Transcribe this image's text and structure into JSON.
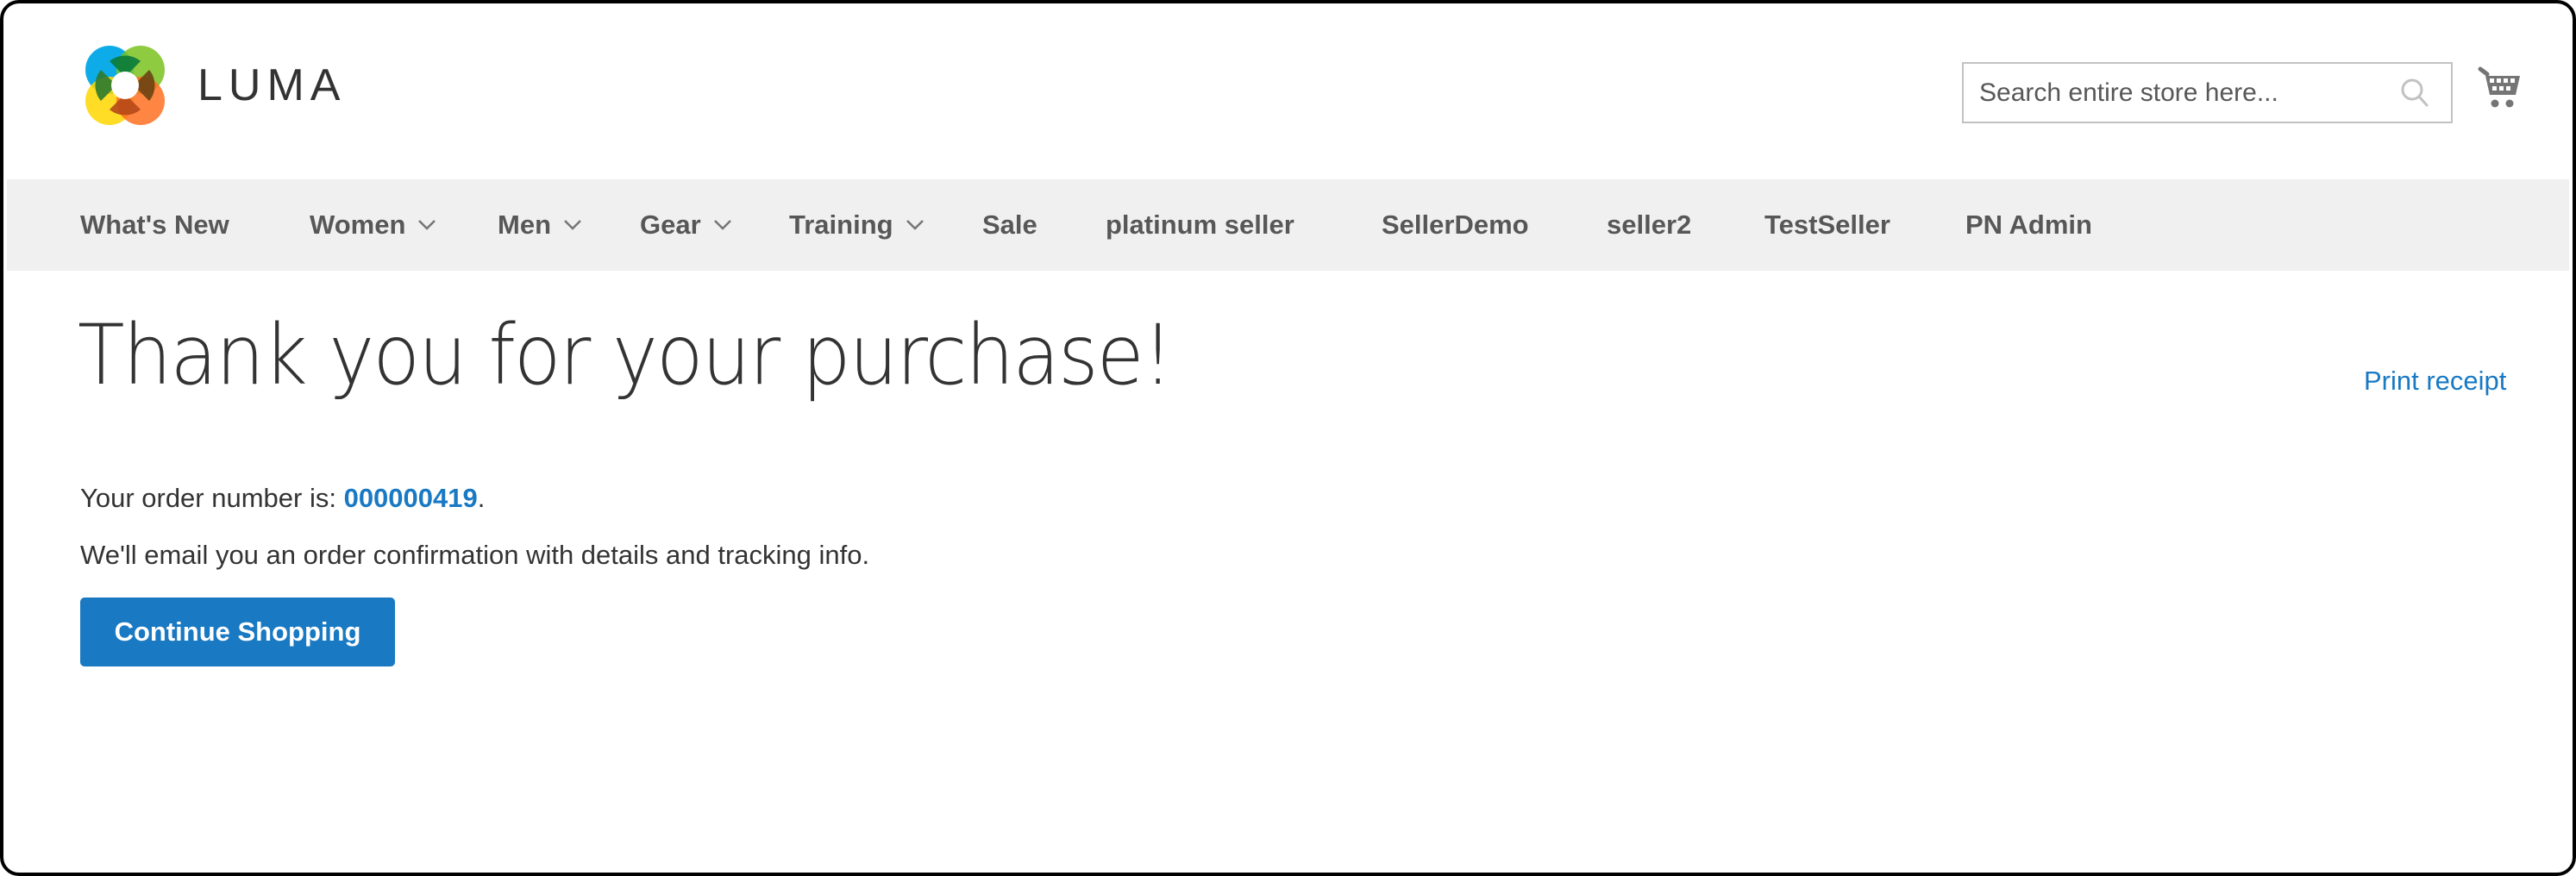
{
  "header": {
    "logo_text": "LUMA",
    "logo_icon": "luma-logo-icon",
    "search": {
      "placeholder": "Search entire store here...",
      "value": "",
      "icon": "search-icon"
    },
    "cart_icon": "cart-icon"
  },
  "nav": {
    "items": [
      {
        "label": "What's New",
        "has_dropdown": false
      },
      {
        "label": "Women",
        "has_dropdown": true
      },
      {
        "label": "Men",
        "has_dropdown": true
      },
      {
        "label": "Gear",
        "has_dropdown": true
      },
      {
        "label": "Training",
        "has_dropdown": true
      },
      {
        "label": "Sale",
        "has_dropdown": false
      },
      {
        "label": "platinum seller",
        "has_dropdown": false
      },
      {
        "label": "SellerDemo",
        "has_dropdown": false
      },
      {
        "label": "seller2",
        "has_dropdown": false
      },
      {
        "label": "TestSeller",
        "has_dropdown": false
      },
      {
        "label": "PN Admin",
        "has_dropdown": false
      }
    ]
  },
  "main": {
    "title": "Thank you for your purchase!",
    "print_receipt": "Print receipt",
    "order_prefix": "Your order number is: ",
    "order_number": "000000419",
    "order_suffix": ".",
    "email_message": "We'll email you an order confirmation with details and tracking info.",
    "continue_button": "Continue Shopping"
  },
  "colors": {
    "accent": "#1979c3",
    "nav_background": "#f0f0f0",
    "text": "#333333",
    "nav_text": "#575757",
    "logo_blue": "#00a8e8",
    "logo_green": "#7ac21e",
    "logo_yellow": "#ffd600",
    "logo_orange": "#ff7021"
  }
}
